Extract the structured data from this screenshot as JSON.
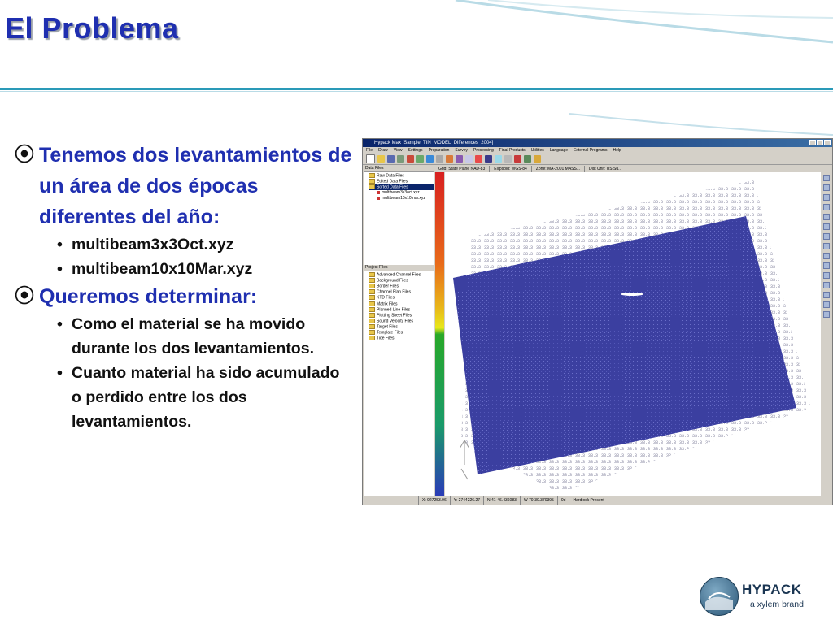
{
  "slide": {
    "title": "El Problema",
    "bullets": [
      {
        "text": "Tenemos dos levantamientos de un área de dos épocas diferentes del año:",
        "sub": [
          "multibeam3x3Oct.xyz",
          "multibeam10x10Mar.xyz"
        ]
      },
      {
        "text": "Queremos determinar:",
        "sub": [
          "Como el material se ha movido durante los dos levantamientos.",
          "Cuanto material ha sido acumulado o perdido entre los dos levantamientos."
        ]
      }
    ],
    "bullet_mark": "⦿"
  },
  "screenshot": {
    "window_title": "Hypack Max [Sample_TIN_MODEL_Differences_2004]",
    "menu": [
      "File",
      "Draw",
      "View",
      "Settings",
      "Preparation",
      "Survey",
      "Processing",
      "Final Products",
      "Utilities",
      "Language",
      "External Programs",
      "Help"
    ],
    "map_info": [
      "Grid: State Plane NAD-83",
      "Ellipsoid: WGS-84",
      "Zone: MA-2001 MASS...",
      "Dist Unit: US Su..."
    ],
    "data_files_header": "Data Files",
    "data_files": [
      "Raw Data Files",
      "Edited Data Files",
      "Sorted Data Files"
    ],
    "sorted_children": [
      "multibeam3x3oct.xyz",
      "multibeam10x10mar.xyz"
    ],
    "project_files_header": "Project Files",
    "project_files": [
      "Advanced Channel Files",
      "Background Files",
      "Border Files",
      "Channel Plan Files",
      "KTD Files",
      "Matrix Files",
      "Planned Line Files",
      "Plotting Sheet Files",
      "Sound Velocity Files",
      "Target Files",
      "Template Files",
      "Tide Files"
    ],
    "status": [
      "X: 927253.96",
      "Y: 2744226.27",
      "N 41-46.436083",
      "W 70-30.370395",
      "0d",
      "Hardlock Present"
    ],
    "colors": {
      "survey_fill": "#3b3fa0",
      "title_bar": "#0a246a"
    }
  },
  "logo": {
    "name": "HYPACK",
    "tagline": "a xylem brand"
  }
}
